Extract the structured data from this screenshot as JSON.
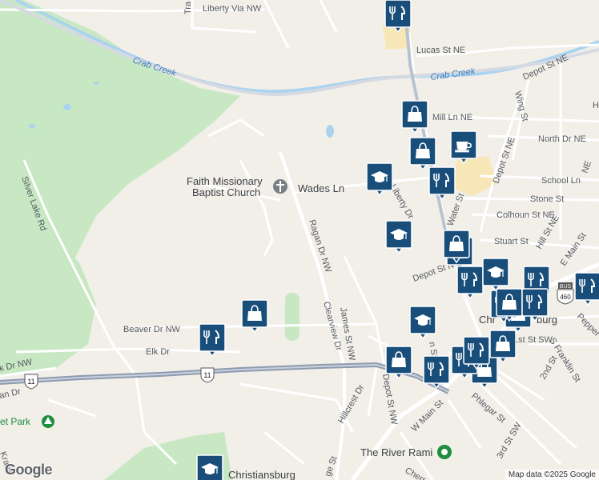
{
  "map": {
    "attribution": "Map data ©2025 Google",
    "logo": "Google",
    "places": [
      {
        "id": "faith-church-1",
        "text": "Faith Missionary"
      },
      {
        "id": "faith-church-2",
        "text": "Baptist Church"
      },
      {
        "id": "river-rami",
        "text": "The River Rami"
      },
      {
        "id": "park",
        "text": "et Park"
      },
      {
        "id": "christiansburg-top",
        "text": "Chr"
      },
      {
        "id": "christiansburg-top2",
        "text": "burg"
      },
      {
        "id": "christiansburg-bottom",
        "text": "Christiansburg"
      }
    ],
    "water": [
      {
        "id": "crab-creek-1",
        "text": "Crab Creek"
      },
      {
        "id": "crab-creek-2",
        "text": "Crab Creek"
      }
    ],
    "streets": [
      {
        "id": "liberty-via",
        "text": "Liberty Via NW"
      },
      {
        "id": "tra",
        "text": "Tra"
      },
      {
        "id": "lucas",
        "text": "Lucas St NE"
      },
      {
        "id": "depot-ne",
        "text": "Depot St NE"
      },
      {
        "id": "mill-ln",
        "text": "Mill Ln NE"
      },
      {
        "id": "wing-st",
        "text": "Wing St"
      },
      {
        "id": "north-dr",
        "text": "North Dr NE"
      },
      {
        "id": "school-ln",
        "text": "School Ln"
      },
      {
        "id": "depot-st-ne",
        "text": "Depot St NE"
      },
      {
        "id": "stone-st",
        "text": "Stone St"
      },
      {
        "id": "colhoun",
        "text": "Colhoun St NE"
      },
      {
        "id": "wades-ln",
        "text": "Wades Ln"
      },
      {
        "id": "liberty-dr",
        "text": "Liberty Dr"
      },
      {
        "id": "water-st",
        "text": "Water St"
      },
      {
        "id": "stuart-st",
        "text": "Stuart St"
      },
      {
        "id": "hill-st",
        "text": "Hill St NE"
      },
      {
        "id": "main-e",
        "text": "E Main St"
      },
      {
        "id": "ragan",
        "text": "Ragan Dr NW"
      },
      {
        "id": "clearview",
        "text": "Clearview Dr"
      },
      {
        "id": "james",
        "text": "James St NW"
      },
      {
        "id": "depot-nw",
        "text": "Depot St NW"
      },
      {
        "id": "depot-nw-2",
        "text": "Depot St NW"
      },
      {
        "id": "silver-lake",
        "text": "Silver Lake Rd"
      },
      {
        "id": "beaver",
        "text": "Beaver Dr NW"
      },
      {
        "id": "elk",
        "text": "Elk Dr"
      },
      {
        "id": "k-dr",
        "text": "k Dr NW"
      },
      {
        "id": "an",
        "text": "an Dr"
      },
      {
        "id": "hillcrest",
        "text": "Hillcrest Dr"
      },
      {
        "id": "main-w",
        "text": "W Main St"
      },
      {
        "id": "phlegar",
        "text": "Phlegar St"
      },
      {
        "id": "first-sw",
        "text": "1st St SW"
      },
      {
        "id": "second-st",
        "text": "2nd St"
      },
      {
        "id": "franklin",
        "text": "S Franklin St"
      },
      {
        "id": "third-sw",
        "text": "3rd St SW"
      },
      {
        "id": "pepper",
        "text": "Pepper"
      },
      {
        "id": "cherry",
        "text": "Cherr"
      },
      {
        "id": "ge-st",
        "text": "ge St"
      },
      {
        "id": "st-vert",
        "text": "St"
      },
      {
        "id": "main-st-frag",
        "text": "n St"
      },
      {
        "id": "kraus",
        "text": "Kraus"
      },
      {
        "id": "h-ne",
        "text": "H"
      },
      {
        "id": "ne-edge",
        "text": "NE"
      }
    ],
    "shields": [
      {
        "id": "us11-left",
        "text": "11"
      },
      {
        "id": "us11-mid",
        "text": "11"
      },
      {
        "id": "us460",
        "text": "460"
      },
      {
        "id": "bus",
        "text": "BUS"
      }
    ],
    "pins": [
      {
        "icon": "restaurant"
      },
      {
        "icon": "shopping"
      },
      {
        "icon": "shopping"
      },
      {
        "icon": "cafe"
      },
      {
        "icon": "school"
      },
      {
        "icon": "restaurant"
      },
      {
        "icon": "school"
      },
      {
        "icon": "shopping"
      },
      {
        "icon": "shopping"
      },
      {
        "icon": "restaurant"
      },
      {
        "icon": "restaurant"
      },
      {
        "icon": "school"
      },
      {
        "icon": "restaurant"
      },
      {
        "icon": "restaurant"
      },
      {
        "icon": "shopping"
      },
      {
        "icon": "restaurant"
      },
      {
        "icon": "school"
      },
      {
        "icon": "shopping"
      },
      {
        "icon": "shopping"
      },
      {
        "icon": "shopping"
      },
      {
        "icon": "restaurant"
      },
      {
        "icon": "restaurant"
      },
      {
        "icon": "restaurant"
      },
      {
        "icon": "shopping"
      },
      {
        "icon": "shopping"
      },
      {
        "icon": "school"
      },
      {
        "icon": "restaurant"
      }
    ],
    "colors": {
      "land": "#f2efe9",
      "park": "#c8e6c9",
      "road": "#ffffff",
      "highway": "#8d9bb0",
      "water": "#aad3f0",
      "pin": "#1a4e7a",
      "urban": "#f6e4b0"
    }
  }
}
